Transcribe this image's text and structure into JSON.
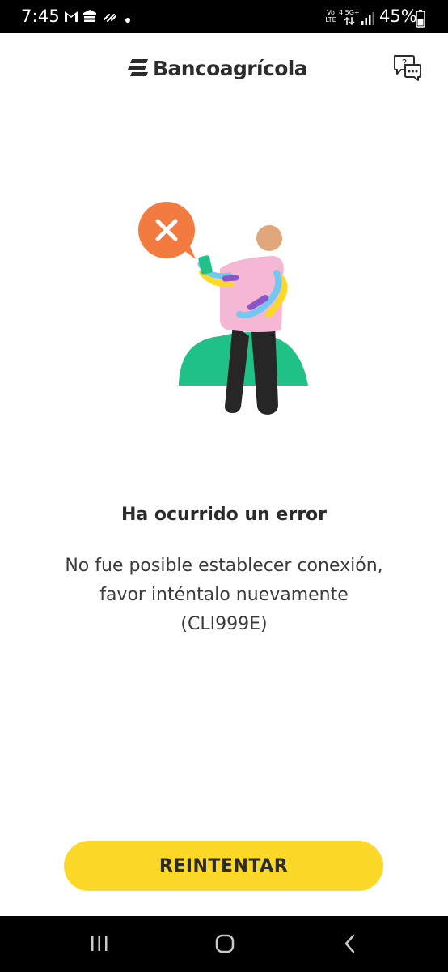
{
  "status_bar": {
    "time": "7:45",
    "network_label_left": "Vo LTE",
    "network_label_right": "4.5G+",
    "battery_percent": "45%"
  },
  "header": {
    "brand_name": "Bancoagrícola",
    "help_icon": "chat-help-icon"
  },
  "error": {
    "title": "Ha ocurrido un error",
    "message_lines": [
      "No fue posible establecer conexión,",
      "favor inténtalo nuevamente",
      "(CLI999E)"
    ]
  },
  "actions": {
    "retry_label": "REINTENTAR"
  },
  "colors": {
    "accent_yellow": "#fcd928",
    "error_orange": "#f47b3f",
    "hill_green": "#1fc186",
    "shirt_pink": "#f5b8d4",
    "skin": "#e1a77a"
  }
}
